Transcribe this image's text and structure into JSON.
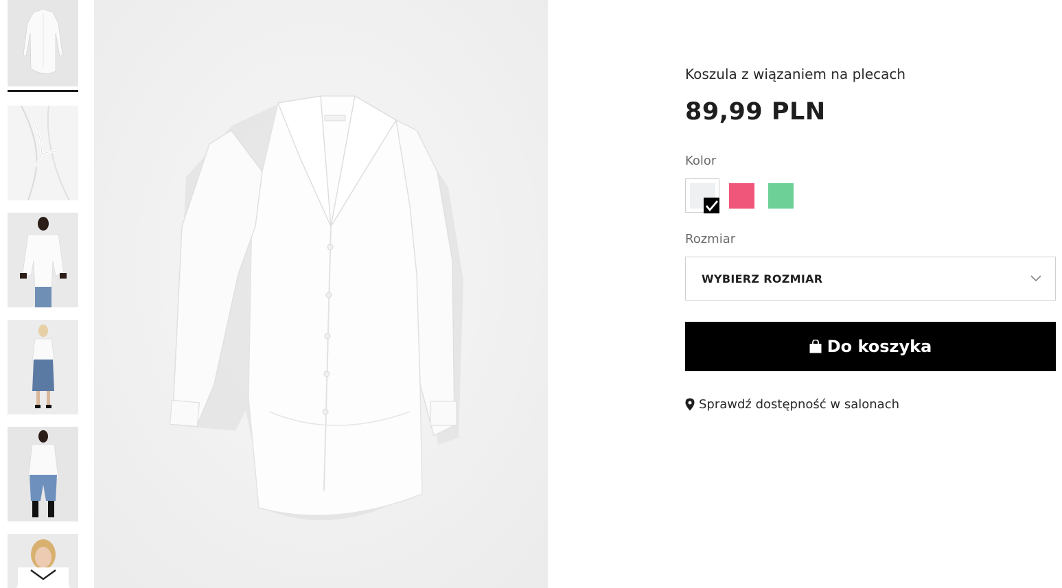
{
  "product": {
    "title": "Koszula z wiązaniem na plecach",
    "price": "89,99 PLN"
  },
  "color": {
    "label": "Kolor",
    "swatches": [
      {
        "name": "white",
        "hex": "#eef0f2",
        "selected": true
      },
      {
        "name": "pink",
        "hex": "#f0557a",
        "selected": false
      },
      {
        "name": "green",
        "hex": "#6dd197",
        "selected": false
      }
    ]
  },
  "size": {
    "label": "Rozmiar",
    "selected_value": "WYBIERZ ROZMIAR"
  },
  "cart": {
    "button_label": "Do koszyka",
    "icon": "shopping-bag-icon"
  },
  "store_availability": {
    "label": "Sprawdź dostępność w salonach",
    "icon": "map-pin-icon"
  },
  "gallery": {
    "thumbnails": [
      {
        "name": "shirt-flat-front",
        "active": true
      },
      {
        "name": "shirt-back-tie-detail",
        "active": false
      },
      {
        "name": "model-front",
        "active": false
      },
      {
        "name": "model-denim-skirt",
        "active": false
      },
      {
        "name": "model-culottes",
        "active": false
      },
      {
        "name": "model-closeup",
        "active": false
      }
    ],
    "next_icon": "chevron-down-icon"
  },
  "colors": {
    "button_bg": "#000000",
    "text_primary": "#1e1e1e",
    "text_muted": "#6b6b6b"
  }
}
